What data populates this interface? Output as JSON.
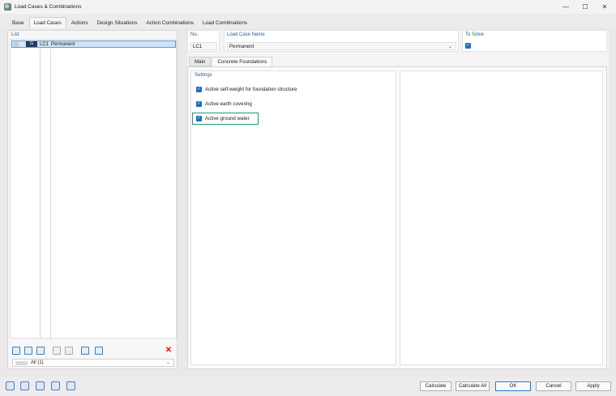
{
  "window": {
    "title": "Load Cases & Combinations",
    "minimize": "—",
    "maximize": "☐",
    "close": "✕"
  },
  "tabs": [
    "Base",
    "Load Cases",
    "Actions",
    "Design Situations",
    "Action Combinations",
    "Load Combinations"
  ],
  "active_tab": "Load Cases",
  "list": {
    "label": "List",
    "rows": [
      {
        "group": "G",
        "id": "LC1",
        "name": "Permanent"
      }
    ],
    "filter_value": "All (1)"
  },
  "header": {
    "no_label": "No.",
    "no_value": "LC1",
    "name_label": "Load Case Name",
    "name_value": "Permanent",
    "to_solve_label": "To Solve",
    "to_solve_checked": true
  },
  "subtabs": [
    "Main",
    "Concrete Foundations"
  ],
  "active_subtab": "Concrete Foundations",
  "settings": {
    "label": "Settings",
    "options": [
      {
        "label": "Active self-weight for foundation structure",
        "checked": true
      },
      {
        "label": "Active earth covering",
        "checked": true
      },
      {
        "label": "Active ground water",
        "checked": true
      }
    ],
    "highlighted_option": "Active ground water"
  },
  "footer": {
    "icons": [
      "search-icon",
      "units-icon",
      "table-icon",
      "filter-icon",
      "function-icon"
    ],
    "buttons": {
      "calculate": "Calculate",
      "calculate_all": "Calculate All",
      "ok": "OK",
      "cancel": "Cancel",
      "apply": "Apply"
    }
  },
  "colors": {
    "accent": "#1d6ec2",
    "highlight": "#1a9a78",
    "delete": "#d21f1f"
  }
}
